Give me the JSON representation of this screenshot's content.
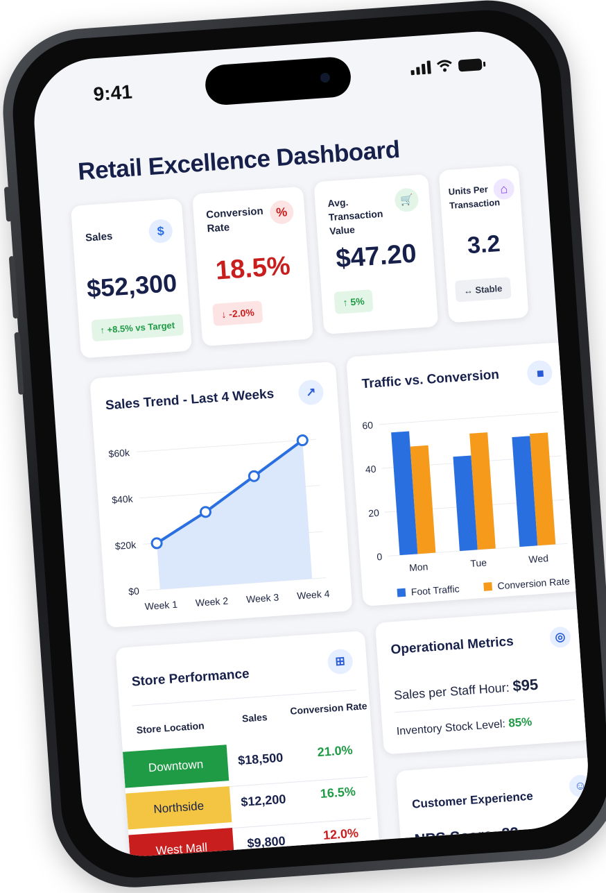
{
  "status": {
    "time": "9:41"
  },
  "title": "Retail Excellence Dashboard",
  "kpis": [
    {
      "label": "Sales",
      "icon_text": "$",
      "icon": "dollar-icon",
      "value": "$52,300",
      "badge": "↑ +8.5% vs Target",
      "badge_tone": "positive"
    },
    {
      "label": "Conversion Rate",
      "icon_text": "%",
      "icon": "percent-icon",
      "value": "18.5%",
      "badge": "↓ -2.0%",
      "badge_tone": "negative"
    },
    {
      "label": "Avg. Transaction Value",
      "icon_text": "🛒",
      "icon": "cart-icon",
      "value": "$47.20",
      "badge": "↑ 5%",
      "badge_tone": "positive"
    },
    {
      "label": "Units Per Transaction",
      "icon_text": "⌂",
      "icon": "bag-icon",
      "value": "3.2",
      "badge": "↔ Stable",
      "badge_tone": "neutral"
    }
  ],
  "sales_trend": {
    "title": "Sales Trend - Last 4 Weeks",
    "icon": "trend-icon",
    "icon_text": "↗"
  },
  "traffic": {
    "title": "Traffic vs. Conversion",
    "icon": "bar-chart-icon",
    "icon_text": "▮▮"
  },
  "chart_data": [
    {
      "type": "area",
      "title": "Sales Trend - Last 4 Weeks",
      "categories": [
        "Week 1",
        "Week 2",
        "Week 3",
        "Week 4"
      ],
      "values": [
        20000,
        32000,
        46000,
        60000
      ],
      "y_ticks": [
        "$0",
        "$20k",
        "$40k",
        "$60k"
      ],
      "ylim": [
        0,
        60000
      ],
      "grid": true,
      "color": "#2a6fe0"
    },
    {
      "type": "bar",
      "title": "Traffic vs. Conversion",
      "categories": [
        "Mon",
        "Tue",
        "Wed"
      ],
      "y_ticks": [
        "0",
        "20",
        "40",
        "60"
      ],
      "ylim": [
        0,
        60
      ],
      "series": [
        {
          "name": "Foot Traffic",
          "values": [
            56,
            43,
            50
          ],
          "color": "#2a6fe0"
        },
        {
          "name": "Conversion Rate",
          "values": [
            49,
            53,
            51
          ],
          "color": "#f59a1b"
        }
      ],
      "legend": "bottom",
      "grid": true
    }
  ],
  "store_performance": {
    "title": "Store Performance",
    "icon": "store-icon",
    "icon_text": "⊞",
    "headers": [
      "Store Location",
      "Sales",
      "Conversion Rate"
    ],
    "rows": [
      {
        "location": "Downtown",
        "sales": "$18,500",
        "rate": "21.0%",
        "color": "#1f9a45",
        "rate_color": "#1f9a45",
        "text_color": "#ffffff"
      },
      {
        "location": "Northside",
        "sales": "$12,200",
        "rate": "16.5%",
        "color": "#f4c542",
        "rate_color": "#1f9a45",
        "text_color": "#16204a"
      },
      {
        "location": "West Mall",
        "sales": "$9,800",
        "rate": "12.0%",
        "color": "#c81e1e",
        "rate_color": "#c81e1e",
        "text_color": "#ffffff"
      }
    ]
  },
  "operational": {
    "title": "Operational Metrics",
    "icon": "target-icon",
    "icon_text": "◎",
    "staff_label": "Sales per Staff Hour:",
    "staff_value": "$95",
    "inventory_label": "Inventory Stock Level:",
    "inventory_value": "85%"
  },
  "customer": {
    "title": "Customer Experience",
    "icon": "user-icon",
    "icon_text": "☺",
    "nps": "NPS Score: 82",
    "stars": "★★★★★"
  }
}
